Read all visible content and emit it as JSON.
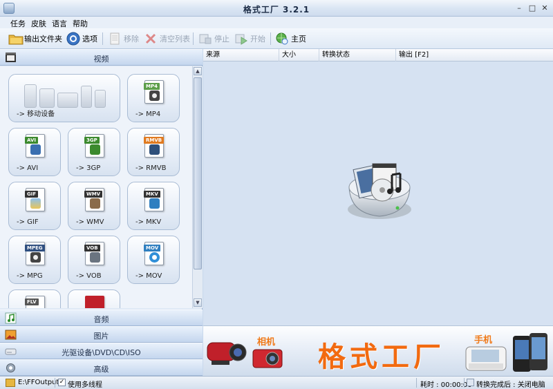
{
  "window": {
    "title": "格式工厂 3.2.1"
  },
  "menu": [
    "任务",
    "皮肤",
    "语言",
    "帮助"
  ],
  "toolbar": {
    "output_folder": "输出文件夹",
    "options": "选项",
    "remove": "移除",
    "clear_list": "清空列表",
    "stop": "停止",
    "start": "开始",
    "home": "主页"
  },
  "sidebar": {
    "categories": {
      "video": "视频",
      "audio": "音频",
      "picture": "图片",
      "rom": "光驱设备\\DVD\\CD\\ISO",
      "advanced": "高级"
    },
    "formats": [
      {
        "label": "-> 移动设备",
        "badge": ""
      },
      {
        "label": "-> MP4",
        "badge": "MP4",
        "color": "#5c9e4a"
      },
      {
        "label": "-> AVI",
        "badge": "AVI",
        "color": "#3c8a2e"
      },
      {
        "label": "-> 3GP",
        "badge": "3GP",
        "color": "#3c8a2e"
      },
      {
        "label": "-> RMVB",
        "badge": "RMVB",
        "color": "#e07a20"
      },
      {
        "label": "-> GIF",
        "badge": "GIF",
        "color": "#333333"
      },
      {
        "label": "-> WMV",
        "badge": "WMV",
        "color": "#333333"
      },
      {
        "label": "-> MKV",
        "badge": "MKV",
        "color": "#333333"
      },
      {
        "label": "-> MPG",
        "badge": "MPEG",
        "color": "#2f4f80"
      },
      {
        "label": "-> VOB",
        "badge": "VOB",
        "color": "#333333"
      },
      {
        "label": "-> MOV",
        "badge": "MOV",
        "color": "#2f7fc0"
      },
      {
        "label": "",
        "badge": "FLV",
        "color": "#555555"
      },
      {
        "label": "",
        "badge": "",
        "color": "#c0202a"
      }
    ]
  },
  "task_list": {
    "columns": [
      "来源",
      "大小",
      "转换状态",
      "输出 [F2]"
    ]
  },
  "banner": {
    "brand": "格式工厂",
    "camera_tag": "相机",
    "phone_tag": "手机"
  },
  "status": {
    "output_path": "E:\\FFOutput",
    "multithread": "使用多线程",
    "elapsed": "耗时 : 00:00:00",
    "after_convert": "转换完成后 : 关闭电脑"
  },
  "colors": {
    "accent": "#f26a10",
    "panel": "#dfe9f6"
  }
}
